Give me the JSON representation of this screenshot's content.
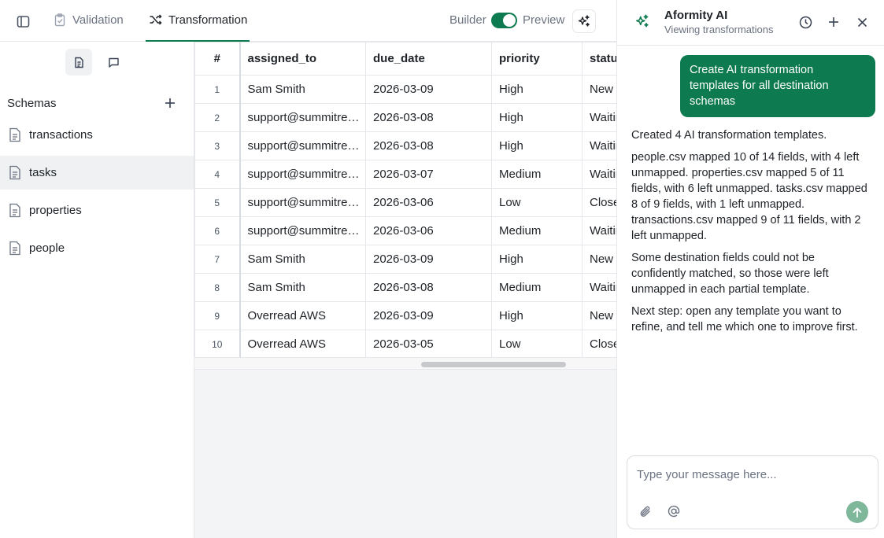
{
  "topbar": {
    "tabs": [
      {
        "label": "Validation",
        "icon": "clipboard-check-icon"
      },
      {
        "label": "Transformation",
        "icon": "shuffle-icon"
      }
    ],
    "builder_label": "Builder",
    "preview_label": "Preview",
    "toggle_on": true
  },
  "sidebar": {
    "heading": "Schemas",
    "items": [
      {
        "label": "transactions"
      },
      {
        "label": "tasks"
      },
      {
        "label": "properties"
      },
      {
        "label": "people"
      }
    ],
    "selected": "tasks"
  },
  "table": {
    "columns": [
      "#",
      "assigned_to",
      "due_date",
      "priority",
      "status"
    ],
    "rows": [
      {
        "n": "1",
        "assigned_to": "Sam Smith",
        "due_date": "2026-03-09",
        "priority": "High",
        "status": "New"
      },
      {
        "n": "2",
        "assigned_to": "support@summitrealty.com",
        "due_date": "2026-03-08",
        "priority": "High",
        "status": "Waiting"
      },
      {
        "n": "3",
        "assigned_to": "support@summitrealty.com",
        "due_date": "2026-03-08",
        "priority": "High",
        "status": "Waiting"
      },
      {
        "n": "4",
        "assigned_to": "support@summitrealty.com",
        "due_date": "2026-03-07",
        "priority": "Medium",
        "status": "Waiting"
      },
      {
        "n": "5",
        "assigned_to": "support@summitrealty.com",
        "due_date": "2026-03-06",
        "priority": "Low",
        "status": "Closed"
      },
      {
        "n": "6",
        "assigned_to": "support@summitrealty.com",
        "due_date": "2026-03-06",
        "priority": "Medium",
        "status": "Waiting"
      },
      {
        "n": "7",
        "assigned_to": "Sam Smith",
        "due_date": "2026-03-09",
        "priority": "High",
        "status": "New"
      },
      {
        "n": "8",
        "assigned_to": "Sam Smith",
        "due_date": "2026-03-08",
        "priority": "Medium",
        "status": "Waiting"
      },
      {
        "n": "9",
        "assigned_to": "Overread AWS",
        "due_date": "2026-03-09",
        "priority": "High",
        "status": "New"
      },
      {
        "n": "10",
        "assigned_to": "Overread AWS",
        "due_date": "2026-03-05",
        "priority": "Low",
        "status": "Closed"
      }
    ]
  },
  "assistant": {
    "title": "Aformity AI",
    "subtitle": "Viewing transformations",
    "user_message": "Create AI transformation templates for all destination schemas",
    "reply": [
      "Created 4 AI transformation templates.",
      "people.csv mapped 10 of 14 fields, with 4 left unmapped. properties.csv mapped 5 of 11 fields, with 6 left unmapped. tasks.csv mapped 8 of 9 fields, with 1 left unmapped. transactions.csv mapped 9 of 11 fields, with 2 left unmapped.",
      "Some destination fields could not be confidently matched, so those were left unmapped in each partial template.",
      "Next step: open any template you want to refine, and tell me which one to improve first."
    ],
    "composer_placeholder": "Type your message here..."
  },
  "colors": {
    "accent": "#0d7a4f",
    "send_button": "#7fb79b",
    "selected_row": "#f0f1f3"
  }
}
